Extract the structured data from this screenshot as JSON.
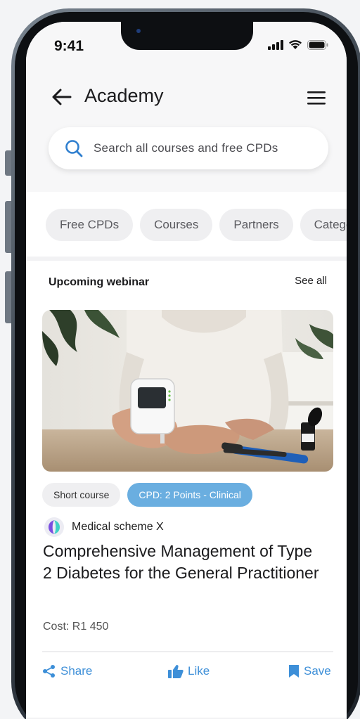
{
  "status_bar": {
    "time": "9:41"
  },
  "header": {
    "title": "Academy",
    "back_icon": "arrow-left-icon",
    "menu_icon": "hamburger-menu-icon"
  },
  "search": {
    "placeholder": "Search all courses and free CPDs",
    "value": ""
  },
  "chips": [
    {
      "label": "Free CPDs"
    },
    {
      "label": "Courses"
    },
    {
      "label": "Partners"
    },
    {
      "label": "Categories"
    }
  ],
  "section": {
    "title": "Upcoming webinar",
    "see_all": "See all"
  },
  "card": {
    "tags": [
      {
        "label": "Short course"
      },
      {
        "label": "CPD: 2 Points - Clinical"
      }
    ],
    "provider": "Medical scheme X",
    "title": "Comprehensive Management of Type 2 Diabetes for the General Practitioner",
    "cost": "Cost: R1 450",
    "actions": {
      "share": "Share",
      "like": "Like",
      "save": "Save"
    }
  },
  "colors": {
    "accent_blue": "#3d8fd8",
    "tag_blue": "#6aaee0",
    "chip_bg": "#efeff1",
    "header_bg": "#f7f7f8"
  }
}
